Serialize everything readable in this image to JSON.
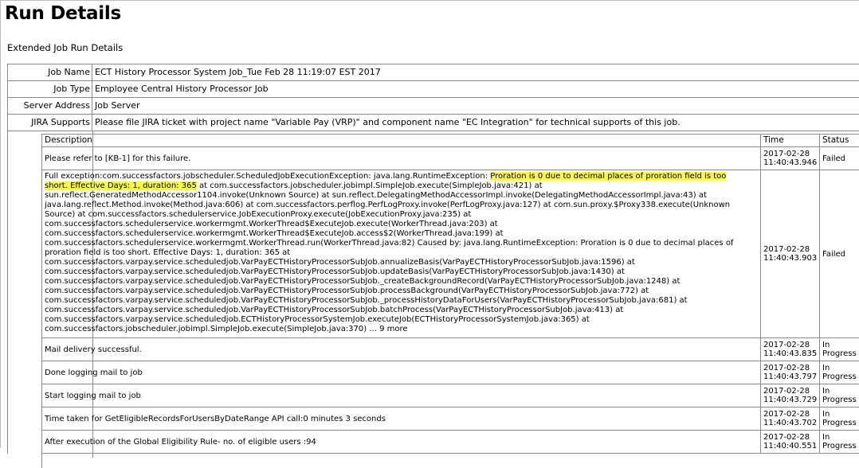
{
  "page": {
    "title": "Run Details",
    "subtitle": "Extended Job Run Details"
  },
  "info": [
    {
      "label": "Job Name",
      "value": "ECT History Processor System Job_Tue Feb 28 11:19:07 EST 2017"
    },
    {
      "label": "Job Type",
      "value": "Employee Central History Processor Job"
    },
    {
      "label": "Server Address",
      "value": "Job Server"
    },
    {
      "label": "JIRA Supports",
      "value": "Please file JIRA ticket with project name \"Variable Pay (VRP)\" and component name \"EC Integration\" for technical supports of this job."
    }
  ],
  "table": {
    "headers": {
      "description": "Description",
      "time": "Time",
      "status": "Status"
    },
    "rows": [
      {
        "description": "Please refer to [KB-1] for this failure.",
        "time": "2017-02-28 11:40:43.946",
        "status": "Failed"
      },
      {
        "description_pre": "Full exception:com.successfactors.jobscheduler.ScheduledJobExecutionException: java.lang.RuntimeException: ",
        "description_highlight": "Proration is 0 due to decimal places of proration field is too short. Effective Days: 1, duration: 365",
        "description_post": " at com.successfactors.jobscheduler.jobimpl.SimpleJob.execute(SimpleJob.java:421) at sun.reflect.GeneratedMethodAccessor1104.invoke(Unknown Source) at sun.reflect.DelegatingMethodAccessorImpl.invoke(DelegatingMethodAccessorImpl.java:43) at java.lang.reflect.Method.invoke(Method.java:606) at com.successfactors.perflog.PerfLogProxy.invoke(PerfLogProxy.java:127) at com.sun.proxy.$Proxy338.execute(Unknown Source) at com.successfactors.schedulerservice.JobExecutionProxy.execute(JobExecutionProxy.java:235) at com.successfactors.schedulerservice.workermgmt.WorkerThread$ExecuteJob.execute(WorkerThread.java:203) at com.successfactors.schedulerservice.workermgmt.WorkerThread$ExecuteJob.access$2(WorkerThread.java:199) at com.successfactors.schedulerservice.workermgmt.WorkerThread.run(WorkerThread.java:82) Caused by: java.lang.RuntimeException: Proration is 0 due to decimal places of proration field is too short. Effective Days: 1, duration: 365 at com.successfactors.varpay.service.scheduledjob.VarPayECTHistoryProcessorSubJob.annualizeBasis(VarPayECTHistoryProcessorSubJob.java:1596) at com.successfactors.varpay.service.scheduledjob.VarPayECTHistoryProcessorSubJob.updateBasis(VarPayECTHistoryProcessorSubJob.java:1430) at com.successfactors.varpay.service.scheduledjob.VarPayECTHistoryProcessorSubJob._createBackgroundRecord(VarPayECTHistoryProcessorSubJob.java:1248) at com.successfactors.varpay.service.scheduledjob.VarPayECTHistoryProcessorSubJob.processBackground(VarPayECTHistoryProcessorSubJob.java:772) at com.successfactors.varpay.service.scheduledjob.VarPayECTHistoryProcessorSubJob._processHistoryDataForUsers(VarPayECTHistoryProcessorSubJob.java:681) at com.successfactors.varpay.service.scheduledjob.VarPayECTHistoryProcessorSubJob.batchProcess(VarPayECTHistoryProcessorSubJob.java:413) at com.successfactors.varpay.service.scheduledjob.ECTHistoryProcessorSystemJob.executeJob(ECTHistoryProcessorSystemJob.java:365) at com.successfactors.jobscheduler.jobimpl.SimpleJob.execute(SimpleJob.java:370) ... 9 more",
        "time": "2017-02-28 11:40:43.903",
        "status": "Failed"
      },
      {
        "description": "Mail delivery successful.",
        "time": "2017-02-28 11:40:43.835",
        "status": "In Progress"
      },
      {
        "description": "Done logging mail to job",
        "time": "2017-02-28 11:40:43.797",
        "status": "In Progress"
      },
      {
        "description": "Start logging mail to job",
        "time": "2017-02-28 11:40:43.729",
        "status": "In Progress"
      },
      {
        "description": "Time taken for GetEligibleRecordsForUsersByDateRange API call:0 minutes 3 seconds",
        "time": "2017-02-28 11:40:43.702",
        "status": "In Progress"
      },
      {
        "description": "After execution of the Global Eligibility Rule- no. of eligible users :94",
        "time": "2017-02-28 11:40:40.551",
        "status": "In Progress"
      }
    ]
  },
  "colors": {
    "highlight": "#f7f75a",
    "border": "#8a8a8a"
  }
}
